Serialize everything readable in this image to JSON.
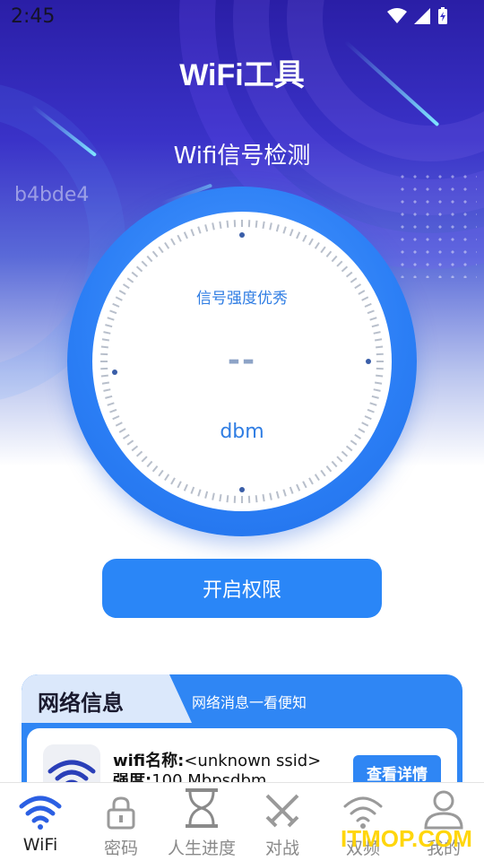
{
  "status_bar": {
    "time": "2:45"
  },
  "header": {
    "title": "WiFi工具"
  },
  "section": {
    "title": "Wifi信号检测"
  },
  "overlay_code": "b4bde4",
  "gauge": {
    "label": "信号强度优秀",
    "value": "--",
    "unit": "dbm"
  },
  "main_button": {
    "label": "开启权限"
  },
  "info_card": {
    "tab_title": "网络信息",
    "subtitle": "网络消息一看便知",
    "wifi_name_label": "wifi名称:",
    "wifi_name_value": "<unknown ssid>",
    "strength_label": "强度:",
    "strength_value": "100 Mbpsdbm",
    "detail_button": "查看详情"
  },
  "bottom_nav": {
    "items": [
      {
        "label": "WiFi",
        "icon": "wifi-icon",
        "active": true
      },
      {
        "label": "密码",
        "icon": "lock-icon",
        "active": false
      },
      {
        "label": "人生进度",
        "icon": "hourglass-icon",
        "active": false
      },
      {
        "label": "对战",
        "icon": "crossed-swords-icon",
        "active": false
      },
      {
        "label": "双频",
        "icon": "wifi-outline-icon",
        "active": false
      },
      {
        "label": "我的",
        "icon": "user-icon",
        "active": false
      }
    ]
  },
  "watermark": "ITMOP.COM",
  "colors": {
    "accent": "#2a86f7",
    "gauge_text": "#2f7de3",
    "hero_top": "#2a1ea6"
  }
}
